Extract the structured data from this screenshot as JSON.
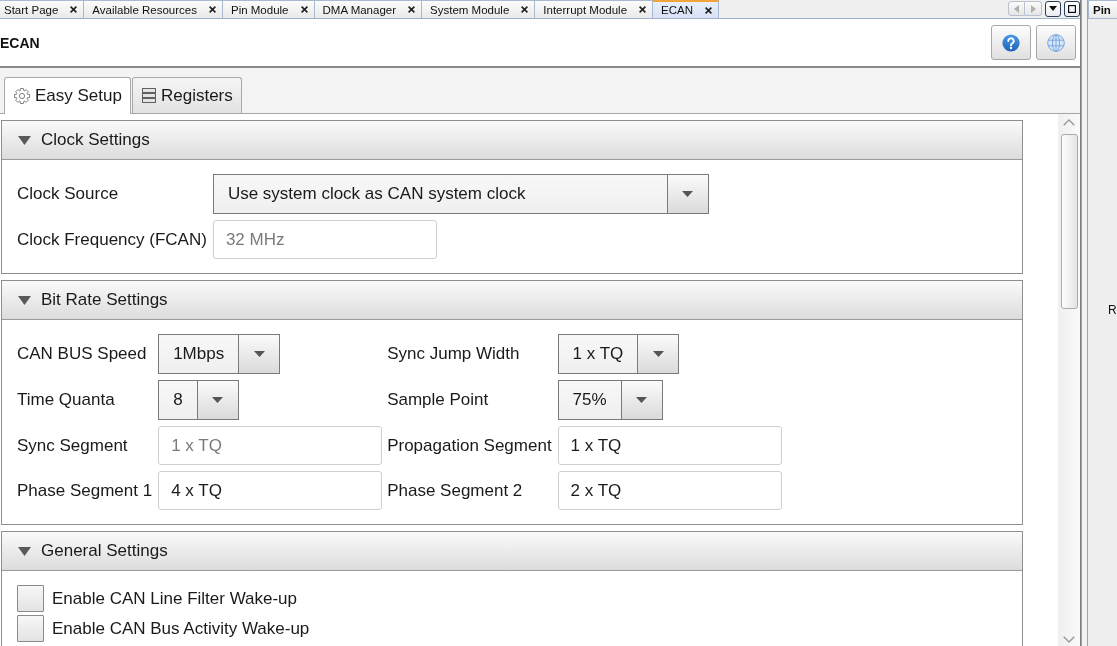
{
  "document_tabs": [
    {
      "label": "Start Page",
      "selected": false
    },
    {
      "label": "Available Resources",
      "selected": false
    },
    {
      "label": "Pin Module",
      "selected": false
    },
    {
      "label": "DMA Manager",
      "selected": false
    },
    {
      "label": "System Module",
      "selected": false
    },
    {
      "label": "Interrupt Module",
      "selected": false
    },
    {
      "label": "ECAN",
      "selected": true
    }
  ],
  "editor": {
    "title": "ECAN"
  },
  "view_tabs": [
    {
      "label": "Easy Setup",
      "selected": true
    },
    {
      "label": "Registers",
      "selected": false
    }
  ],
  "sections": [
    {
      "title": "Clock Settings",
      "expanded": true,
      "rows": [
        [
          {
            "kind": "dropdown",
            "label": "Clock Source",
            "value": "Use system clock as CAN system clock",
            "disabled": false
          }
        ],
        [
          {
            "kind": "text",
            "label": "Clock Frequency (FCAN)",
            "value": "32 MHz",
            "disabled": true
          }
        ]
      ]
    },
    {
      "title": "Bit Rate Settings",
      "expanded": true,
      "rows": [
        [
          {
            "kind": "dropdown",
            "label": "CAN BUS Speed",
            "value": "1Mbps",
            "disabled": false
          },
          {
            "kind": "dropdown",
            "label": "Sync Jump Width",
            "value": "1 x TQ",
            "disabled": false
          }
        ],
        [
          {
            "kind": "dropdown",
            "label": "Time Quanta",
            "value": "8",
            "disabled": false
          },
          {
            "kind": "dropdown",
            "label": "Sample Point",
            "value": "75%",
            "disabled": false
          }
        ],
        [
          {
            "kind": "text",
            "label": "Sync Segment",
            "value": "1 x TQ",
            "disabled": true
          },
          {
            "kind": "text",
            "label": "Propagation Segment",
            "value": "1 x TQ",
            "disabled": false
          }
        ],
        [
          {
            "kind": "text",
            "label": "Phase Segment 1",
            "value": "4 x TQ",
            "disabled": false
          },
          {
            "kind": "text",
            "label": "Phase Segment 2",
            "value": "2 x TQ",
            "disabled": false
          }
        ]
      ]
    },
    {
      "title": "General Settings",
      "expanded": true,
      "rows": [
        [
          {
            "kind": "checkbox",
            "label": "Enable CAN Line Filter Wake-up",
            "checked": false
          }
        ],
        [
          {
            "kind": "checkbox",
            "label": "Enable CAN Bus Activity Wake-up",
            "checked": false
          }
        ]
      ]
    }
  ],
  "side_panel": {
    "tab": "Pin",
    "texts": [
      "R"
    ]
  }
}
